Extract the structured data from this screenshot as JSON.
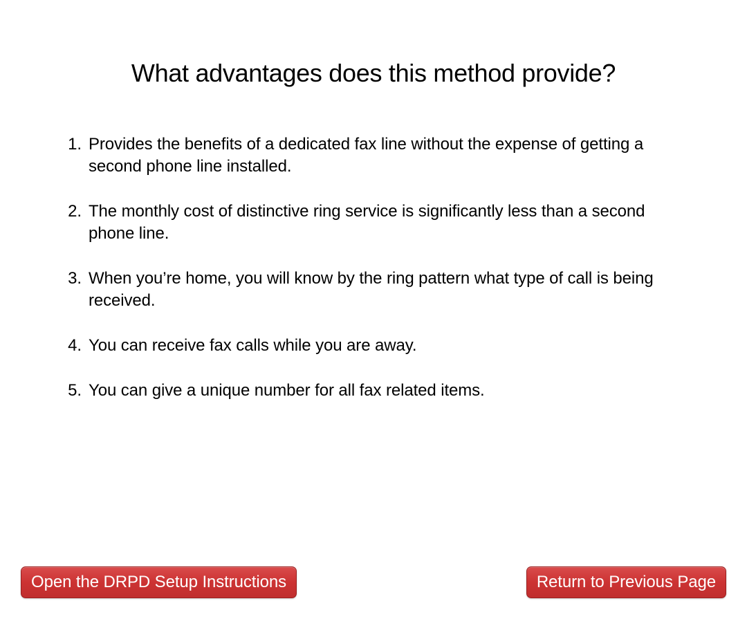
{
  "title": "What advantages does this method provide?",
  "items": [
    "Provides the benefits of a dedicated fax line without the expense of getting a second phone line installed.",
    "The monthly cost of distinctive ring service is significantly less than a second phone line.",
    "When you’re home, you will know by the ring pattern what type of call is being received.",
    "You can receive fax calls while you are away.",
    "You can give a unique number for all fax related items."
  ],
  "buttons": {
    "open_instructions": "Open the DRPD Setup Instructions",
    "return_previous": "Return to Previous Page"
  }
}
